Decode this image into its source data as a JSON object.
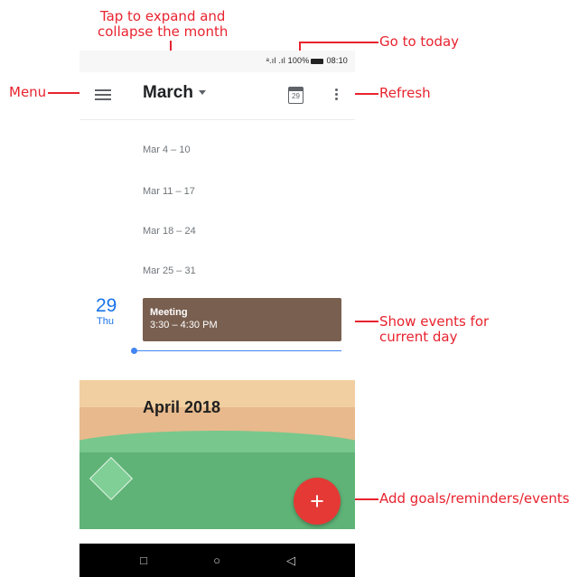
{
  "callouts": {
    "tap_expand": "Tap to expand and\ncollapse the month",
    "go_to_today": "Go to today",
    "menu": "Menu",
    "refresh": "Refresh",
    "show_events": "Show events for\ncurrent day",
    "add_goals": "Add goals/reminders/events"
  },
  "status_bar": {
    "text": "ᵃ.ıl .ıl 100%",
    "time": "08:10"
  },
  "app_bar": {
    "month": "March",
    "today_date": "29",
    "menu_icon": "hamburger-icon",
    "overflow_icon": "more-vert-icon"
  },
  "weeks": [
    {
      "label": "Mar 4 – 10"
    },
    {
      "label": "Mar 11 – 17"
    },
    {
      "label": "Mar 18 – 24"
    },
    {
      "label": "Mar 25 – 31"
    }
  ],
  "today": {
    "day_number": "29",
    "day_name": "Thu"
  },
  "event": {
    "title": "Meeting",
    "time": "3:30 – 4:30 PM",
    "color": "#795f4f"
  },
  "month_banner": {
    "title": "April 2018"
  },
  "fab": {
    "symbol": "+",
    "color": "#e53935"
  },
  "nav_bar": {
    "square": "□",
    "circle": "○",
    "back": "◁"
  },
  "colors": {
    "callout": "#e8232f",
    "accent": "#1a73e8"
  }
}
